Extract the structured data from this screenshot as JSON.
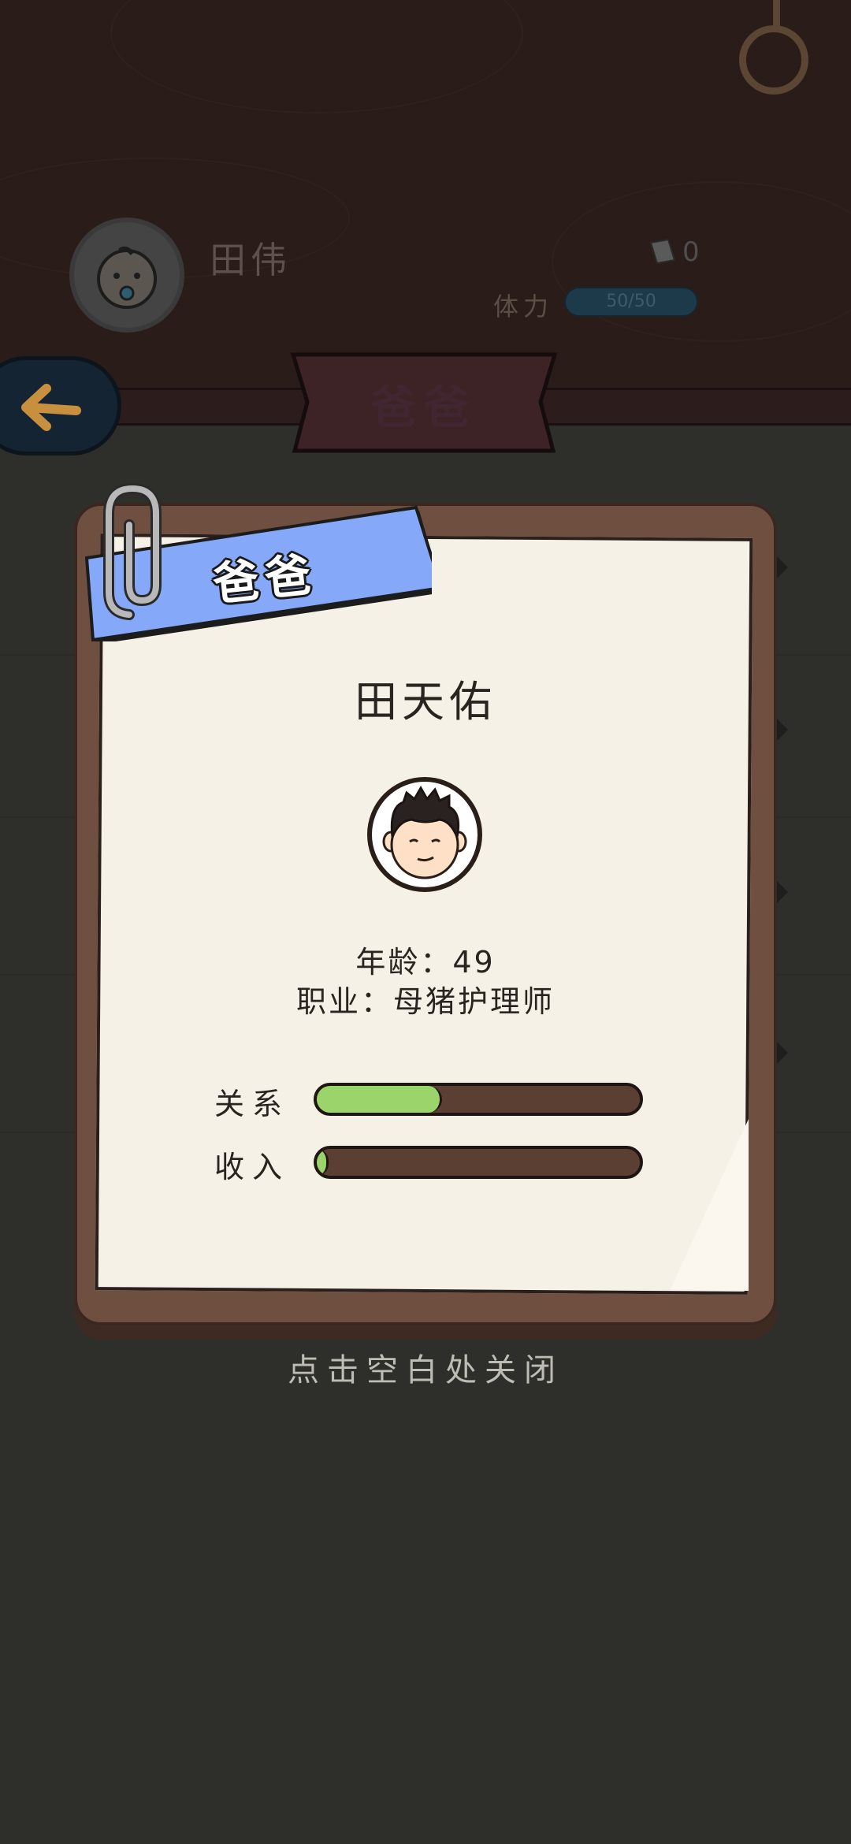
{
  "background": {
    "player_name": "田伟",
    "ticket_count": "0",
    "stamina_label": "体力",
    "stamina_value": "50/50",
    "screen_title": "爸爸"
  },
  "modal": {
    "ribbon_label": "爸爸",
    "name": "田天佑",
    "age_line": "年龄：49",
    "job_line": "职业：母猪护理师",
    "stats": [
      {
        "label": "关系",
        "value": 0.38
      },
      {
        "label": "收入",
        "value": 0.02
      }
    ],
    "colors": {
      "ribbon": "#86a8f8",
      "stat_fill": "#9ad46a",
      "card_frame": "#6e4f40",
      "paper": "#f6f1e6"
    }
  },
  "close_hint": "点击空白处关闭",
  "icons": [
    "back-arrow-icon",
    "ticket-icon",
    "paperclip-icon",
    "baby-avatar-icon",
    "father-avatar-icon"
  ]
}
